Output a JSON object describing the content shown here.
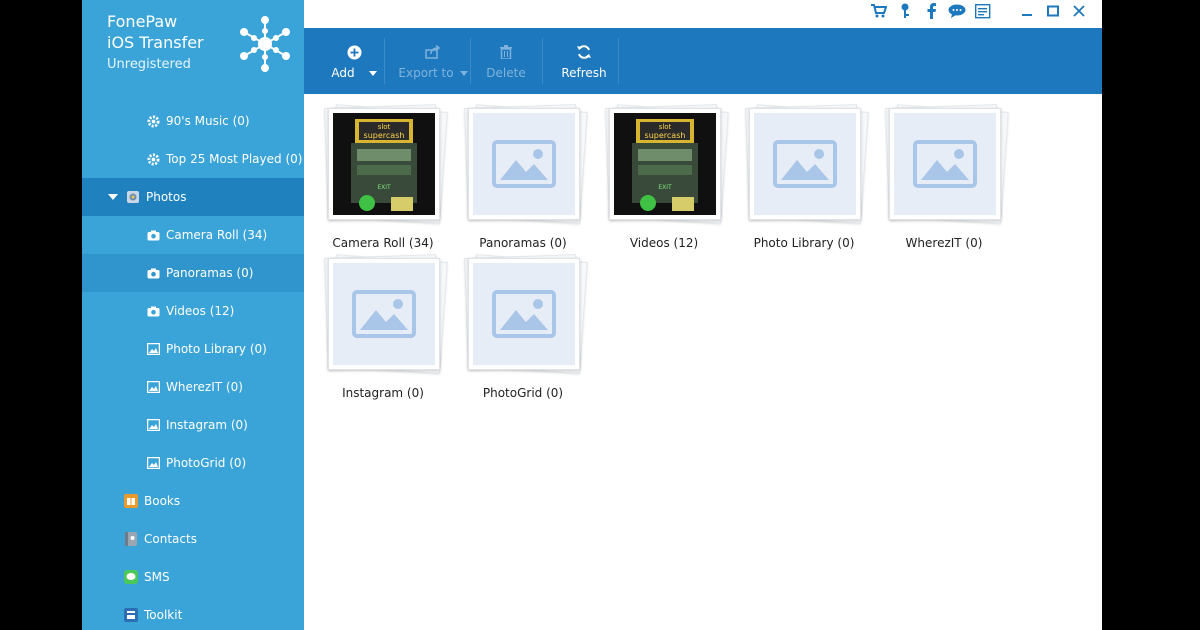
{
  "app": {
    "brand": {
      "line1": "FonePaw",
      "line2": "iOS Transfer",
      "status": "Unregistered"
    },
    "accent": "#3aa4d8",
    "toolbar_color": "#1e78bd"
  },
  "sidebar": {
    "items": [
      {
        "label": "90's Music (0)",
        "icon": "gear-icon"
      },
      {
        "label": "Top 25 Most Played (0)",
        "icon": "gear-icon"
      },
      {
        "label": "Photos",
        "icon": "photos-icon"
      },
      {
        "label": "Camera Roll (34)",
        "icon": "camera-icon"
      },
      {
        "label": "Panoramas (0)",
        "icon": "camera-icon"
      },
      {
        "label": "Videos (12)",
        "icon": "camera-icon"
      },
      {
        "label": "Photo Library (0)",
        "icon": "picture-icon"
      },
      {
        "label": "WherezIT (0)",
        "icon": "picture-icon"
      },
      {
        "label": "Instagram (0)",
        "icon": "picture-icon"
      },
      {
        "label": "PhotoGrid (0)",
        "icon": "picture-icon"
      },
      {
        "label": "Books",
        "icon": "books-icon"
      },
      {
        "label": "Contacts",
        "icon": "contacts-icon"
      },
      {
        "label": "SMS",
        "icon": "sms-icon"
      },
      {
        "label": "Toolkit",
        "icon": "toolkit-icon"
      }
    ]
  },
  "toolbar": {
    "add": "Add",
    "export": "Export to",
    "delete": "Delete",
    "refresh": "Refresh"
  },
  "window_controls": [
    "cart-icon",
    "key-icon",
    "facebook-icon",
    "feedback-icon",
    "register-icon",
    "minimize-icon",
    "maximize-icon",
    "close-icon"
  ],
  "albums": [
    {
      "label": "Camera Roll (34)",
      "thumb": "photo",
      "thumb_text": [
        "slot",
        "supercash",
        "EXIT"
      ]
    },
    {
      "label": "Panoramas (0)",
      "thumb": "placeholder"
    },
    {
      "label": "Videos (12)",
      "thumb": "photo",
      "thumb_text": [
        "slot",
        "supercash",
        "EXIT"
      ]
    },
    {
      "label": "Photo Library (0)",
      "thumb": "placeholder"
    },
    {
      "label": "WherezIT (0)",
      "thumb": "placeholder"
    },
    {
      "label": "Instagram (0)",
      "thumb": "placeholder"
    },
    {
      "label": "PhotoGrid (0)",
      "thumb": "placeholder"
    }
  ]
}
